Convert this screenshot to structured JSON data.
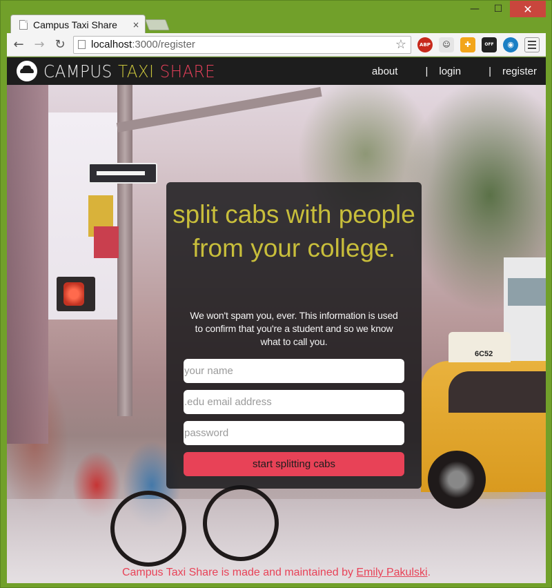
{
  "window": {
    "minimize_symbol": "—",
    "maximize_symbol": "☐",
    "close_symbol": "✕"
  },
  "tab": {
    "title": "Campus Taxi Share",
    "close_symbol": "×"
  },
  "toolbar": {
    "back_symbol": "←",
    "forward_symbol": "→",
    "reload_symbol": "↻",
    "url_host": "localhost",
    "url_path": ":3000/register",
    "star_symbol": "☆",
    "extensions": [
      {
        "name": "adblock-plus-icon",
        "label": "ABP"
      },
      {
        "name": "dog-extension-icon",
        "label": "☺"
      },
      {
        "name": "grid-extension-icon",
        "label": "✚"
      },
      {
        "name": "off-toggle-icon",
        "label": "OFF"
      },
      {
        "name": "eye-extension-icon",
        "label": "◉"
      }
    ]
  },
  "site": {
    "brand": {
      "campus": "CAMPUS",
      "taxi": "TAXI",
      "share": "SHARE"
    },
    "nav": {
      "about": "about",
      "login": "login",
      "register": "register",
      "separator": "|"
    }
  },
  "card": {
    "headline": "split cabs with people from your college.",
    "subtext": "We won't spam you, ever. This information is used to confirm that you're a student and so we know what to call you.",
    "name_placeholder": "your name",
    "email_placeholder": ".edu email address",
    "password_placeholder": "password",
    "submit_label": "start splitting cabs"
  },
  "footer": {
    "text_prefix": "Campus Taxi Share is made and maintained by ",
    "author": "Emily Pakulski",
    "text_suffix": "."
  },
  "colors": {
    "accent_yellow": "#c8be3b",
    "accent_red": "#e84257",
    "header_bg": "#1d1d1d",
    "window_frame": "#71a02a"
  }
}
